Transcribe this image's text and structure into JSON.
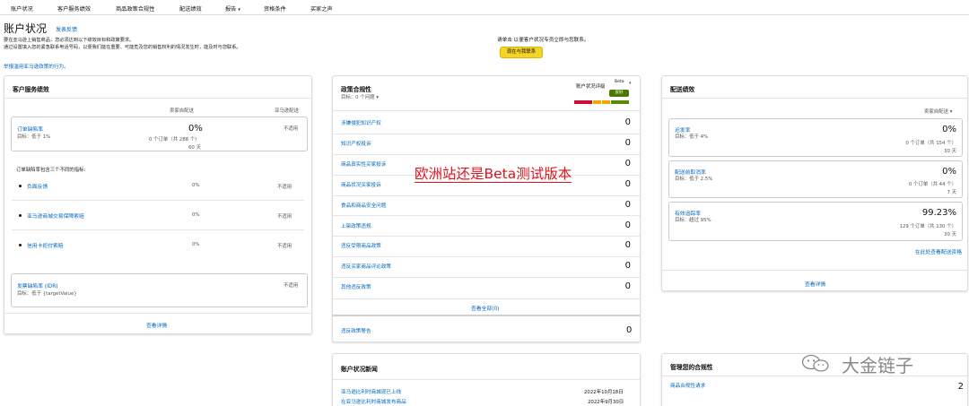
{
  "nav": {
    "items": [
      "账户状况",
      "客户服务绩效",
      "商品政策合规性",
      "配送绩效",
      "报告",
      "资格条件",
      "买家之声"
    ]
  },
  "header": {
    "title": "账户状况",
    "feedback": "发表反馈",
    "intro_line1": "要在亚马逊上销售商品，您必须达到以下绩效目标和政策要求。",
    "intro_line2": "通过设置填入您的紧急联系电话号码，以便我们能在重要、可能危及您的销售权利的情况发生时，能及时与您联系。",
    "intro_link": "设置",
    "report_link": "举报滥用亚马逊政策的行为。",
    "hotline": "请单击 以便客户状况专员立即与您联系。",
    "contact_button": "现在与我联系"
  },
  "customer_service": {
    "title": "客户服务绩效",
    "col_seller": "卖家自配送",
    "col_amazon": "亚马逊配送",
    "odr_label": "订单缺陷率",
    "odr_target": "目标：低于 1%",
    "odr_value": "0%",
    "odr_orders": "0 个订单（共 288 个）",
    "odr_days": "60 天",
    "odr_amazon": "不适用",
    "metrics_intro": "订单缺陷率包含三个不同的指标:",
    "metrics": [
      {
        "label": "负面反馈",
        "value": "0%",
        "amazon": "不适用"
      },
      {
        "label": "亚马逊商城交易保障索赔",
        "value": "0%",
        "amazon": "不适用"
      },
      {
        "label": "信用卡拒付索赔",
        "value": "0%",
        "amazon": "不适用"
      }
    ],
    "idr_label": "发票缺陷率 (IDR)",
    "idr_target": "目标：低于 {targetValue}",
    "idr_amazon": "不适用",
    "details": "查看详情"
  },
  "policy": {
    "title": "政策合规性",
    "target": "目标：0 个问题",
    "health_label": "账户状况评级",
    "beta": "Beta",
    "badge": "良好",
    "seg_colors": [
      "#cc0c39",
      "#f0a800",
      "#f0a800",
      "#5a8a00"
    ],
    "rows": [
      {
        "label": "涉嫌侵犯知识产权",
        "count": "0"
      },
      {
        "label": "知识产权投诉",
        "count": "0"
      },
      {
        "label": "商品真实性买家投诉",
        "count": "0"
      },
      {
        "label": "商品状况买家投诉",
        "count": "0"
      },
      {
        "label": "食品和商品安全问题",
        "count": "0"
      },
      {
        "label": "上架政策违规",
        "count": "0"
      },
      {
        "label": "违反受限商品政策",
        "count": "0"
      },
      {
        "label": "违反买家商品评论政策",
        "count": "0"
      },
      {
        "label": "其他违反政策",
        "count": "0"
      }
    ],
    "view_all": "查看全部(0)",
    "warning_label": "违反政策警告",
    "warning_count": "0"
  },
  "delivery": {
    "title": "配送绩效",
    "col_seller": "卖家自配送",
    "items": [
      {
        "label": "迟发率",
        "target": "目标：低于 4%",
        "value": "0%",
        "orders": "0 个订单（共 154 个）",
        "days": "30 天"
      },
      {
        "label": "配送前取消率",
        "target": "目标：低于 2.5%",
        "value": "0%",
        "orders": "0 个订单（共 44 个）",
        "days": "7 天"
      },
      {
        "label": "有效追踪率",
        "target": "目标：超过 95%",
        "value": "99.23%",
        "orders": "129 个订单（共 130 个）",
        "days": "30 天"
      }
    ],
    "more_link": "在此处查看配送资格",
    "details": "查看详情"
  },
  "news": {
    "title": "账户状况新闻",
    "items": [
      {
        "label": "亚马逊比利时商城现已上线",
        "date": "2022年10月18日"
      },
      {
        "label": "在亚马逊比利时商城发布商品",
        "date": "2022年9月30日"
      }
    ]
  },
  "compliance": {
    "title": "管理您的合规性",
    "row_label": "商品合规性请求",
    "row_count": "2"
  },
  "annotation": {
    "beta_note": "欧洲站还是Beta测试版本"
  },
  "watermark": {
    "text": "大金链子",
    "icon": "wechat-icon"
  }
}
